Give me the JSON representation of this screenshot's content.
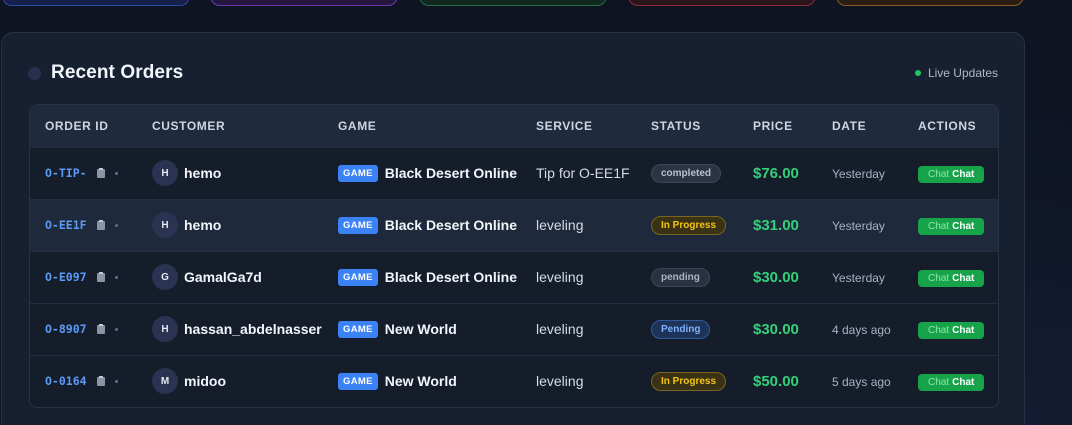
{
  "panel": {
    "title": "Recent Orders",
    "live_label": "Live Updates"
  },
  "table": {
    "headers": [
      "ORDER ID",
      "CUSTOMER",
      "GAME",
      "SERVICE",
      "STATUS",
      "PRICE",
      "DATE",
      "ACTIONS"
    ],
    "rows": [
      {
        "order_id": "O-TIP-",
        "avatar": "H",
        "customer": "hemo",
        "game_tag": "GAME",
        "game": "Black Desert Online",
        "service": "Tip for O-EE1F",
        "status": "completed",
        "price": "$76.00",
        "date": "Yesterday",
        "chat_icon_text": "Chat",
        "chat_label": "Chat"
      },
      {
        "order_id": "O-EE1F",
        "avatar": "H",
        "customer": "hemo",
        "game_tag": "GAME",
        "game": "Black Desert Online",
        "service": "leveling",
        "status": "In Progress",
        "price": "$31.00",
        "date": "Yesterday",
        "chat_icon_text": "Chat",
        "chat_label": "Chat"
      },
      {
        "order_id": "O-E097",
        "avatar": "G",
        "customer": "GamalGa7d",
        "game_tag": "GAME",
        "game": "Black Desert Online",
        "service": "leveling",
        "status": "pending",
        "price": "$30.00",
        "date": "Yesterday",
        "chat_icon_text": "Chat",
        "chat_label": "Chat"
      },
      {
        "order_id": "O-8907",
        "avatar": "H",
        "customer": "hassan_abdelnasser",
        "game_tag": "GAME",
        "game": "New World",
        "service": "leveling",
        "status": "Pending",
        "price": "$30.00",
        "date": "4 days ago",
        "chat_icon_text": "Chat",
        "chat_label": "Chat"
      },
      {
        "order_id": "O-0164",
        "avatar": "M",
        "customer": "midoo",
        "game_tag": "GAME",
        "game": "New World",
        "service": "leveling",
        "status": "In Progress",
        "price": "$50.00",
        "date": "5 days ago",
        "chat_icon_text": "Chat",
        "chat_label": "Chat"
      }
    ]
  },
  "colors": {
    "accent_green": "#34d17a",
    "chat_button": "#16a34a",
    "game_tag": "#3b82f6",
    "order_id": "#5b9bf5",
    "live_dot": "#22c55e"
  },
  "icons": {
    "title_dot": "circle-icon",
    "copy": "clipboard-icon",
    "more": "dot-icon",
    "live": "live-dot-icon"
  }
}
